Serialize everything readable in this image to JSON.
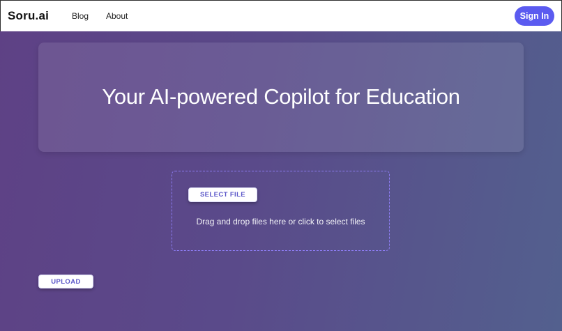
{
  "navbar": {
    "brand": "Soru.ai",
    "links": [
      {
        "label": "Blog"
      },
      {
        "label": "About"
      }
    ],
    "sign_in_label": "Sign In"
  },
  "hero": {
    "title": "Your AI-powered Copilot for Education"
  },
  "dropzone": {
    "select_label": "SELECT FILE",
    "hint": "Drag and drop files here or click to select files"
  },
  "upload_label": "UPLOAD",
  "colors": {
    "accent": "#5b5bf0",
    "button_text": "#5c58c9",
    "dropzone_border": "#8d7cf2",
    "background_start": "#5e4185",
    "background_end": "#53608e"
  }
}
